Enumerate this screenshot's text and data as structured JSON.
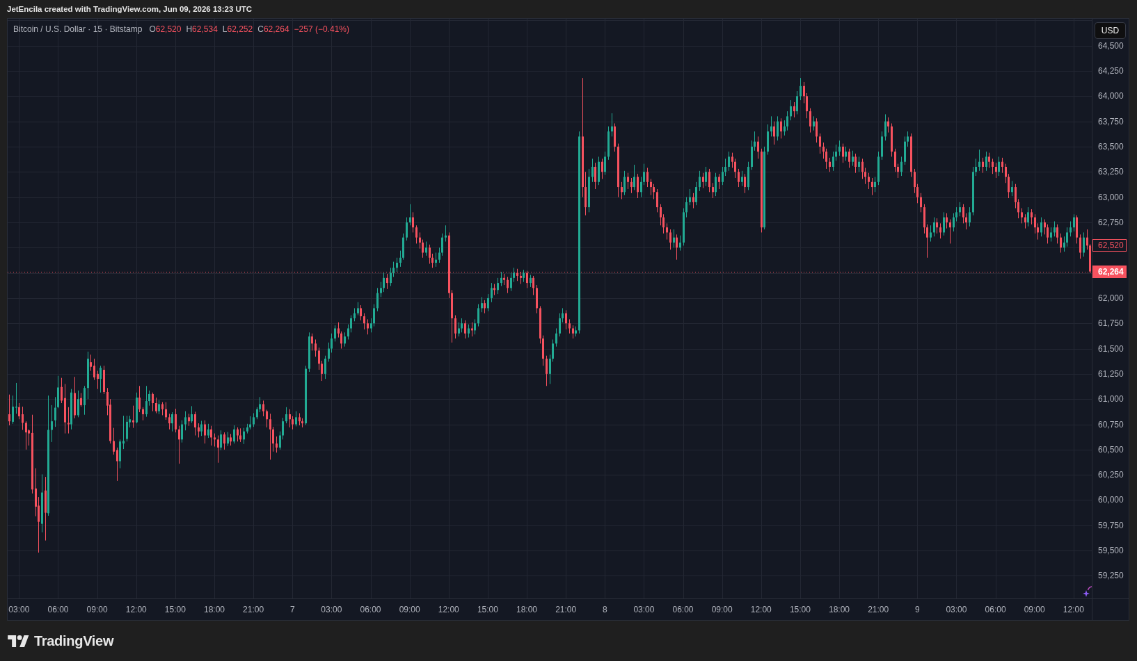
{
  "attribution": "JetEncila created with TradingView.com, Jun 09, 2026 13:23 UTC",
  "legend": {
    "title": "Bitcoin / U.S. Dollar · 15 · Bitstamp",
    "ohlc": [
      {
        "label": "O",
        "value": "62,520"
      },
      {
        "label": "H",
        "value": "62,534"
      },
      {
        "label": "L",
        "value": "62,252"
      },
      {
        "label": "C",
        "value": "62,264"
      }
    ],
    "change": "−257 (−0.41%)"
  },
  "price_scale": {
    "currency": "USD"
  },
  "chart_data": {
    "type": "candlestick",
    "grid": true,
    "ylim": [
      59026,
      64766
    ],
    "yticks": [
      {
        "value": 59250,
        "label": "59,250"
      },
      {
        "value": 59500,
        "label": "59,500"
      },
      {
        "value": 59750,
        "label": "59,750"
      },
      {
        "value": 60000,
        "label": "60,000"
      },
      {
        "value": 60250,
        "label": "60,250"
      },
      {
        "value": 60500,
        "label": "60,500"
      },
      {
        "value": 60750,
        "label": "60,750"
      },
      {
        "value": 61000,
        "label": "61,000"
      },
      {
        "value": 61250,
        "label": "61,250"
      },
      {
        "value": 61500,
        "label": "61,500"
      },
      {
        "value": 61750,
        "label": "61,750"
      },
      {
        "value": 62000,
        "label": "62,000"
      },
      {
        "value": 62750,
        "label": "62,750"
      },
      {
        "value": 63000,
        "label": "63,000"
      },
      {
        "value": 63250,
        "label": "63,250"
      },
      {
        "value": 63500,
        "label": "63,500"
      },
      {
        "value": 63750,
        "label": "63,750"
      },
      {
        "value": 64000,
        "label": "64,000"
      },
      {
        "value": 64250,
        "label": "64,250"
      },
      {
        "value": 64500,
        "label": "64,500"
      }
    ],
    "annotations": [
      "62,520"
    ],
    "ref_lines": [
      {
        "axis": "y",
        "value": 62264,
        "label": "62,264"
      }
    ],
    "categories": [
      null,
      null,
      null,
      "03:00",
      null,
      null,
      null,
      null,
      null,
      null,
      null,
      null,
      null,
      null,
      null,
      "06:00",
      null,
      null,
      null,
      null,
      null,
      null,
      null,
      null,
      null,
      null,
      null,
      "09:00",
      null,
      null,
      null,
      null,
      null,
      null,
      null,
      null,
      null,
      null,
      null,
      "12:00",
      null,
      null,
      null,
      null,
      null,
      null,
      null,
      null,
      null,
      null,
      null,
      "15:00",
      null,
      null,
      null,
      null,
      null,
      null,
      null,
      null,
      null,
      null,
      null,
      "18:00",
      null,
      null,
      null,
      null,
      null,
      null,
      null,
      null,
      null,
      null,
      null,
      "21:00",
      null,
      null,
      null,
      null,
      null,
      null,
      null,
      null,
      null,
      null,
      null,
      "7",
      null,
      null,
      null,
      null,
      null,
      null,
      null,
      null,
      null,
      null,
      null,
      "03:00",
      null,
      null,
      null,
      null,
      null,
      null,
      null,
      null,
      null,
      null,
      null,
      "06:00",
      null,
      null,
      null,
      null,
      null,
      null,
      null,
      null,
      null,
      null,
      null,
      "09:00",
      null,
      null,
      null,
      null,
      null,
      null,
      null,
      null,
      null,
      null,
      null,
      "12:00",
      null,
      null,
      null,
      null,
      null,
      null,
      null,
      null,
      null,
      null,
      null,
      "15:00",
      null,
      null,
      null,
      null,
      null,
      null,
      null,
      null,
      null,
      null,
      null,
      "18:00",
      null,
      null,
      null,
      null,
      null,
      null,
      null,
      null,
      null,
      null,
      null,
      "21:00",
      null,
      null,
      null,
      null,
      null,
      null,
      null,
      null,
      null,
      null,
      null,
      "8",
      null,
      null,
      null,
      null,
      null,
      null,
      null,
      null,
      null,
      null,
      null,
      "03:00",
      null,
      null,
      null,
      null,
      null,
      null,
      null,
      null,
      null,
      null,
      null,
      "06:00",
      null,
      null,
      null,
      null,
      null,
      null,
      null,
      null,
      null,
      null,
      null,
      "09:00",
      null,
      null,
      null,
      null,
      null,
      null,
      null,
      null,
      null,
      null,
      null,
      "12:00",
      null,
      null,
      null,
      null,
      null,
      null,
      null,
      null,
      null,
      null,
      null,
      "15:00",
      null,
      null,
      null,
      null,
      null,
      null,
      null,
      null,
      null,
      null,
      null,
      "18:00",
      null,
      null,
      null,
      null,
      null,
      null,
      null,
      null,
      null,
      null,
      null,
      "21:00",
      null,
      null,
      null,
      null,
      null,
      null,
      null,
      null,
      null,
      null,
      null,
      "9",
      null,
      null,
      null,
      null,
      null,
      null,
      null,
      null,
      null,
      null,
      null,
      "03:00",
      null,
      null,
      null,
      null,
      null,
      null,
      null,
      null,
      null,
      null,
      null,
      "06:00",
      null,
      null,
      null,
      null,
      null,
      null,
      null,
      null,
      null,
      null,
      null,
      "09:00",
      null,
      null,
      null,
      null,
      null,
      null,
      null,
      null,
      null,
      null,
      null,
      "12:00",
      null,
      null,
      null,
      null,
      null
    ],
    "ohlc": [
      [
        60850,
        61045,
        60740,
        60780
      ],
      [
        60775,
        61035,
        60755,
        60925
      ],
      [
        60915,
        61160,
        60855,
        60925
      ],
      [
        60920,
        60960,
        60800,
        60830
      ],
      [
        60850,
        60925,
        60695,
        60765
      ],
      [
        60765,
        60780,
        60500,
        60670
      ],
      [
        60690,
        60700,
        60540,
        60660
      ],
      [
        60665,
        60845,
        60065,
        60105
      ],
      [
        60115,
        60315,
        59840,
        59935
      ],
      [
        59945,
        60030,
        59480,
        59785
      ],
      [
        59765,
        60255,
        59680,
        60075
      ],
      [
        60095,
        60230,
        59600,
        59875
      ],
      [
        59870,
        61035,
        59845,
        60695
      ],
      [
        60695,
        60940,
        60575,
        60780
      ],
      [
        60790,
        61020,
        60725,
        60915
      ],
      [
        60920,
        61230,
        60910,
        61115
      ],
      [
        61120,
        61210,
        60960,
        60985
      ],
      [
        61010,
        61150,
        60660,
        60770
      ],
      [
        60765,
        60920,
        60660,
        60750
      ],
      [
        60750,
        61100,
        60700,
        61065
      ],
      [
        61060,
        61220,
        60810,
        60840
      ],
      [
        60840,
        61085,
        60820,
        61000
      ],
      [
        61010,
        61060,
        60925,
        60940
      ],
      [
        60940,
        61130,
        60845,
        61110
      ],
      [
        61110,
        61470,
        61000,
        61400
      ],
      [
        61365,
        61440,
        61280,
        61320
      ],
      [
        61330,
        61400,
        61190,
        61215
      ],
      [
        61250,
        61280,
        61100,
        61200
      ],
      [
        61200,
        61330,
        61065,
        61310
      ],
      [
        61290,
        61330,
        61050,
        61070
      ],
      [
        61070,
        61110,
        60840,
        60935
      ],
      [
        60945,
        61000,
        60560,
        60585
      ],
      [
        60585,
        60715,
        60450,
        60480
      ],
      [
        60495,
        60520,
        60190,
        60385
      ],
      [
        60385,
        60600,
        60315,
        60580
      ],
      [
        60560,
        60835,
        60505,
        60585
      ],
      [
        60605,
        60835,
        60580,
        60775
      ],
      [
        60770,
        60835,
        60720,
        60800
      ],
      [
        60790,
        60935,
        60715,
        60770
      ],
      [
        60770,
        61065,
        60760,
        61015
      ],
      [
        61015,
        61130,
        60870,
        60900
      ],
      [
        60900,
        60920,
        60790,
        60850
      ],
      [
        60850,
        61130,
        60825,
        60980
      ],
      [
        60980,
        61085,
        60935,
        61050
      ],
      [
        61050,
        61065,
        60880,
        60960
      ],
      [
        60960,
        61015,
        60860,
        60880
      ],
      [
        60880,
        60990,
        60850,
        60950
      ],
      [
        60950,
        60970,
        60840,
        60900
      ],
      [
        60900,
        60970,
        60795,
        60820
      ],
      [
        60820,
        60855,
        60700,
        60760
      ],
      [
        60760,
        60870,
        60680,
        60850
      ],
      [
        60850,
        60905,
        60670,
        60700
      ],
      [
        60700,
        60735,
        60360,
        60600
      ],
      [
        60600,
        60790,
        60570,
        60750
      ],
      [
        60750,
        60880,
        60690,
        60820
      ],
      [
        60820,
        60855,
        60735,
        60780
      ],
      [
        60780,
        60930,
        60765,
        60850
      ],
      [
        60850,
        60875,
        60640,
        60720
      ],
      [
        60720,
        60760,
        60620,
        60680
      ],
      [
        60680,
        60785,
        60635,
        60750
      ],
      [
        60750,
        60790,
        60560,
        60640
      ],
      [
        60640,
        60755,
        60615,
        60700
      ],
      [
        60700,
        60735,
        60540,
        60620
      ],
      [
        60620,
        60660,
        60530,
        60600
      ],
      [
        60600,
        60640,
        60370,
        60520
      ],
      [
        60520,
        60690,
        60495,
        60650
      ],
      [
        60650,
        60670,
        60500,
        60560
      ],
      [
        60560,
        60675,
        60535,
        60620
      ],
      [
        60620,
        60655,
        60540,
        60580
      ],
      [
        60580,
        60740,
        60560,
        60700
      ],
      [
        60700,
        60720,
        60580,
        60640
      ],
      [
        60640,
        60710,
        60575,
        60600
      ],
      [
        60600,
        60715,
        60555,
        60680
      ],
      [
        60680,
        60755,
        60660,
        60720
      ],
      [
        60720,
        60830,
        60700,
        60750
      ],
      [
        60750,
        60860,
        60725,
        60820
      ],
      [
        60820,
        60920,
        60800,
        60900
      ],
      [
        60900,
        61020,
        60870,
        60950
      ],
      [
        60950,
        60985,
        60830,
        60880
      ],
      [
        60880,
        60895,
        60720,
        60800
      ],
      [
        60800,
        60855,
        60400,
        60700
      ],
      [
        60700,
        60725,
        60480,
        60560
      ],
      [
        60560,
        60630,
        60470,
        60520
      ],
      [
        60520,
        60680,
        60500,
        60640
      ],
      [
        60640,
        60815,
        60600,
        60780
      ],
      [
        60780,
        60920,
        60760,
        60850
      ],
      [
        60850,
        60900,
        60720,
        60800
      ],
      [
        60800,
        60830,
        60700,
        60750
      ],
      [
        60750,
        60880,
        60730,
        60820
      ],
      [
        60820,
        60860,
        60740,
        60780
      ],
      [
        60780,
        60810,
        60720,
        60760
      ],
      [
        60760,
        61330,
        60745,
        61300
      ],
      [
        61300,
        61660,
        61270,
        61620
      ],
      [
        61620,
        61650,
        61480,
        61550
      ],
      [
        61550,
        61590,
        61420,
        61480
      ],
      [
        61480,
        61510,
        61290,
        61350
      ],
      [
        61350,
        61380,
        61180,
        61250
      ],
      [
        61250,
        61430,
        61200,
        61400
      ],
      [
        61400,
        61560,
        61370,
        61500
      ],
      [
        61500,
        61650,
        61460,
        61600
      ],
      [
        61600,
        61730,
        61570,
        61700
      ],
      [
        61700,
        61760,
        61610,
        61650
      ],
      [
        61650,
        61670,
        61500,
        61550
      ],
      [
        61550,
        61660,
        61520,
        61620
      ],
      [
        61620,
        61740,
        61590,
        61700
      ],
      [
        61700,
        61830,
        61660,
        61800
      ],
      [
        61800,
        61900,
        61770,
        61850
      ],
      [
        61850,
        61960,
        61830,
        61900
      ],
      [
        61900,
        61930,
        61780,
        61820
      ],
      [
        61820,
        61850,
        61690,
        61750
      ],
      [
        61750,
        61790,
        61640,
        61700
      ],
      [
        61700,
        61800,
        61660,
        61750
      ],
      [
        61750,
        61940,
        61720,
        61900
      ],
      [
        61900,
        62100,
        61870,
        62050
      ],
      [
        62050,
        62160,
        62010,
        62100
      ],
      [
        62100,
        62250,
        62060,
        62200
      ],
      [
        62200,
        62240,
        62090,
        62150
      ],
      [
        62150,
        62300,
        62120,
        62250
      ],
      [
        62250,
        62360,
        62210,
        62300
      ],
      [
        62300,
        62400,
        62260,
        62350
      ],
      [
        62350,
        62470,
        62310,
        62400
      ],
      [
        62400,
        62640,
        62380,
        62600
      ],
      [
        62600,
        62800,
        62570,
        62750
      ],
      [
        62750,
        62930,
        62720,
        62800
      ],
      [
        62800,
        62850,
        62650,
        62700
      ],
      [
        62700,
        62720,
        62540,
        62600
      ],
      [
        62600,
        62650,
        62490,
        62550
      ],
      [
        62550,
        62580,
        62400,
        62450
      ],
      [
        62450,
        62560,
        62420,
        62500
      ],
      [
        62500,
        62530,
        62340,
        62400
      ],
      [
        62400,
        62440,
        62300,
        62350
      ],
      [
        62350,
        62450,
        62310,
        62380
      ],
      [
        62380,
        62500,
        62350,
        62450
      ],
      [
        62450,
        62640,
        62420,
        62600
      ],
      [
        62600,
        62720,
        62560,
        62620
      ],
      [
        62620,
        62650,
        62000,
        62050
      ],
      [
        62050,
        62080,
        61560,
        61800
      ],
      [
        61800,
        61830,
        61600,
        61650
      ],
      [
        61650,
        61760,
        61620,
        61700
      ],
      [
        61700,
        61800,
        61660,
        61750
      ],
      [
        61750,
        61780,
        61600,
        61650
      ],
      [
        61650,
        61740,
        61610,
        61700
      ],
      [
        61700,
        61760,
        61620,
        61680
      ],
      [
        61680,
        61790,
        61640,
        61750
      ],
      [
        61750,
        61940,
        61720,
        61900
      ],
      [
        61900,
        62010,
        61860,
        61950
      ],
      [
        61950,
        61980,
        61850,
        61900
      ],
      [
        61900,
        62040,
        61870,
        62000
      ],
      [
        62000,
        62150,
        61960,
        62100
      ],
      [
        62100,
        62140,
        62030,
        62080
      ],
      [
        62080,
        62200,
        62040,
        62150
      ],
      [
        62150,
        62260,
        62120,
        62200
      ],
      [
        62200,
        62240,
        62130,
        62180
      ],
      [
        62180,
        62210,
        62050,
        62100
      ],
      [
        62100,
        62250,
        62070,
        62200
      ],
      [
        62200,
        62300,
        62160,
        62250
      ],
      [
        62250,
        62290,
        62170,
        62220
      ],
      [
        62220,
        62260,
        62140,
        62200
      ],
      [
        62200,
        62280,
        62160,
        62250
      ],
      [
        62250,
        62270,
        62100,
        62150
      ],
      [
        62150,
        62230,
        62110,
        62200
      ],
      [
        62200,
        62220,
        62030,
        62100
      ],
      [
        62100,
        62130,
        61850,
        61900
      ],
      [
        61900,
        61920,
        61550,
        61600
      ],
      [
        61600,
        61630,
        61330,
        61400
      ],
      [
        61400,
        61430,
        61130,
        61250
      ],
      [
        61250,
        61440,
        61150,
        61400
      ],
      [
        61400,
        61590,
        61370,
        61550
      ],
      [
        61550,
        61700,
        61520,
        61650
      ],
      [
        61650,
        61850,
        61620,
        61800
      ],
      [
        61800,
        61900,
        61760,
        61850
      ],
      [
        61850,
        61880,
        61690,
        61750
      ],
      [
        61750,
        61790,
        61650,
        61700
      ],
      [
        61700,
        61730,
        61600,
        61650
      ],
      [
        61650,
        61720,
        61620,
        61680
      ],
      [
        61680,
        63650,
        61650,
        63600
      ],
      [
        63600,
        64180,
        63000,
        63100
      ],
      [
        63100,
        63250,
        62820,
        62900
      ],
      [
        62900,
        63280,
        62850,
        63200
      ],
      [
        63200,
        63380,
        63150,
        63300
      ],
      [
        63300,
        63340,
        63080,
        63150
      ],
      [
        63150,
        63400,
        63120,
        63350
      ],
      [
        63350,
        63380,
        63180,
        63250
      ],
      [
        63250,
        63450,
        63220,
        63400
      ],
      [
        63400,
        63700,
        63370,
        63650
      ],
      [
        63650,
        63830,
        63600,
        63700
      ],
      [
        63700,
        63730,
        63450,
        63500
      ],
      [
        63500,
        63530,
        63000,
        63100
      ],
      [
        63100,
        63150,
        62980,
        63050
      ],
      [
        63050,
        63260,
        63020,
        63200
      ],
      [
        63200,
        63240,
        63080,
        63150
      ],
      [
        63150,
        63190,
        63040,
        63100
      ],
      [
        63100,
        63320,
        63070,
        63200
      ],
      [
        63200,
        63230,
        62990,
        63050
      ],
      [
        63050,
        63200,
        63000,
        63150
      ],
      [
        63150,
        63330,
        63120,
        63250
      ],
      [
        63250,
        63290,
        63100,
        63150
      ],
      [
        63150,
        63180,
        63020,
        63100
      ],
      [
        63100,
        63130,
        62980,
        63050
      ],
      [
        63050,
        63080,
        62850,
        62900
      ],
      [
        62900,
        62930,
        62720,
        62800
      ],
      [
        62800,
        62830,
        62640,
        62700
      ],
      [
        62700,
        62740,
        62580,
        62650
      ],
      [
        62650,
        62680,
        62480,
        62550
      ],
      [
        62550,
        62680,
        62500,
        62600
      ],
      [
        62600,
        62630,
        62380,
        62500
      ],
      [
        62500,
        62620,
        62470,
        62550
      ],
      [
        62550,
        62890,
        62520,
        62850
      ],
      [
        62850,
        63000,
        62800,
        62950
      ],
      [
        62950,
        63080,
        62920,
        63000
      ],
      [
        63000,
        63040,
        62890,
        62950
      ],
      [
        62950,
        63150,
        62920,
        63100
      ],
      [
        63100,
        63260,
        63060,
        63200
      ],
      [
        63200,
        63240,
        63090,
        63150
      ],
      [
        63150,
        63300,
        63110,
        63250
      ],
      [
        63250,
        63280,
        63050,
        63100
      ],
      [
        63100,
        63140,
        62990,
        63050
      ],
      [
        63050,
        63240,
        63010,
        63200
      ],
      [
        63200,
        63230,
        63080,
        63150
      ],
      [
        63150,
        63300,
        63120,
        63250
      ],
      [
        63250,
        63380,
        63210,
        63300
      ],
      [
        63300,
        63450,
        63260,
        63400
      ],
      [
        63400,
        63440,
        63290,
        63350
      ],
      [
        63350,
        63380,
        63190,
        63250
      ],
      [
        63250,
        63280,
        63100,
        63150
      ],
      [
        63150,
        63260,
        63110,
        63200
      ],
      [
        63200,
        63230,
        63040,
        63100
      ],
      [
        63100,
        63350,
        63070,
        63300
      ],
      [
        63300,
        63560,
        63270,
        63500
      ],
      [
        63500,
        63650,
        63460,
        63550
      ],
      [
        63550,
        63600,
        63380,
        63450
      ],
      [
        63450,
        63480,
        62650,
        62700
      ],
      [
        62700,
        63500,
        62680,
        63450
      ],
      [
        63450,
        63720,
        63420,
        63650
      ],
      [
        63650,
        63800,
        63600,
        63700
      ],
      [
        63700,
        63750,
        63520,
        63600
      ],
      [
        63600,
        63800,
        63560,
        63750
      ],
      [
        63750,
        63780,
        63580,
        63650
      ],
      [
        63650,
        63760,
        63610,
        63700
      ],
      [
        63700,
        63850,
        63660,
        63800
      ],
      [
        63800,
        63960,
        63760,
        63900
      ],
      [
        63900,
        63940,
        63790,
        63850
      ],
      [
        63850,
        64050,
        63820,
        64000
      ],
      [
        64000,
        64180,
        63960,
        64100
      ],
      [
        64100,
        64140,
        63930,
        64000
      ],
      [
        64000,
        64030,
        63780,
        63850
      ],
      [
        63850,
        63880,
        63640,
        63700
      ],
      [
        63700,
        63800,
        63660,
        63750
      ],
      [
        63750,
        63780,
        63540,
        63600
      ],
      [
        63600,
        63630,
        63430,
        63500
      ],
      [
        63500,
        63540,
        63380,
        63450
      ],
      [
        63450,
        63480,
        63280,
        63350
      ],
      [
        63350,
        63390,
        63250,
        63300
      ],
      [
        63300,
        63450,
        63260,
        63400
      ],
      [
        63400,
        63520,
        63360,
        63450
      ],
      [
        63450,
        63560,
        63410,
        63500
      ],
      [
        63500,
        63530,
        63340,
        63400
      ],
      [
        63400,
        63500,
        63360,
        63450
      ],
      [
        63450,
        63480,
        63290,
        63350
      ],
      [
        63350,
        63460,
        63310,
        63400
      ],
      [
        63400,
        63430,
        63240,
        63300
      ],
      [
        63300,
        63400,
        63250,
        63350
      ],
      [
        63350,
        63380,
        63180,
        63250
      ],
      [
        63250,
        63290,
        63130,
        63200
      ],
      [
        63200,
        63240,
        63080,
        63150
      ],
      [
        63150,
        63190,
        63020,
        63100
      ],
      [
        63100,
        63200,
        63050,
        63150
      ],
      [
        63150,
        63450,
        63120,
        63400
      ],
      [
        63400,
        63650,
        63370,
        63600
      ],
      [
        63600,
        63820,
        63560,
        63750
      ],
      [
        63750,
        63790,
        63640,
        63700
      ],
      [
        63700,
        63730,
        63400,
        63450
      ],
      [
        63450,
        63480,
        63250,
        63300
      ],
      [
        63300,
        63330,
        63190,
        63250
      ],
      [
        63250,
        63400,
        63210,
        63350
      ],
      [
        63350,
        63600,
        63320,
        63550
      ],
      [
        63550,
        63650,
        63500,
        63600
      ],
      [
        63600,
        63630,
        63200,
        63250
      ],
      [
        63250,
        63280,
        63040,
        63100
      ],
      [
        63100,
        63130,
        62940,
        63000
      ],
      [
        63000,
        63040,
        62850,
        62900
      ],
      [
        62900,
        62930,
        62640,
        62700
      ],
      [
        62700,
        62730,
        62400,
        62600
      ],
      [
        62600,
        62720,
        62560,
        62650
      ],
      [
        62650,
        62800,
        62610,
        62750
      ],
      [
        62750,
        62790,
        62640,
        62700
      ],
      [
        62700,
        62740,
        62590,
        62650
      ],
      [
        62650,
        62850,
        62620,
        62800
      ],
      [
        62800,
        62840,
        62690,
        62750
      ],
      [
        62750,
        62780,
        62540,
        62700
      ],
      [
        62700,
        62840,
        62660,
        62800
      ],
      [
        62800,
        62900,
        62760,
        62850
      ],
      [
        62850,
        62950,
        62810,
        62900
      ],
      [
        62900,
        62930,
        62740,
        62800
      ],
      [
        62800,
        62840,
        62680,
        62750
      ],
      [
        62750,
        62900,
        62710,
        62850
      ],
      [
        62850,
        63300,
        62820,
        63250
      ],
      [
        63250,
        63380,
        63210,
        63300
      ],
      [
        63300,
        63470,
        63260,
        63350
      ],
      [
        63350,
        63390,
        63240,
        63300
      ],
      [
        63300,
        63450,
        63260,
        63400
      ],
      [
        63400,
        63440,
        63290,
        63350
      ],
      [
        63350,
        63380,
        63230,
        63300
      ],
      [
        63300,
        63340,
        63190,
        63250
      ],
      [
        63250,
        63400,
        63210,
        63350
      ],
      [
        63350,
        63390,
        63240,
        63300
      ],
      [
        63300,
        63330,
        63140,
        63200
      ],
      [
        63200,
        63230,
        62990,
        63050
      ],
      [
        63050,
        63160,
        63010,
        63100
      ],
      [
        63100,
        63130,
        62890,
        62950
      ],
      [
        62950,
        62980,
        62790,
        62850
      ],
      [
        62850,
        62890,
        62740,
        62800
      ],
      [
        62800,
        62830,
        62690,
        62750
      ],
      [
        62750,
        62900,
        62710,
        62850
      ],
      [
        62850,
        62880,
        62730,
        62800
      ],
      [
        62800,
        62830,
        62640,
        62700
      ],
      [
        62700,
        62740,
        62580,
        62650
      ],
      [
        62650,
        62800,
        62610,
        62750
      ],
      [
        62750,
        62780,
        62630,
        62700
      ],
      [
        62700,
        62730,
        62540,
        62600
      ],
      [
        62600,
        62700,
        62560,
        62650
      ],
      [
        62650,
        62760,
        62610,
        62700
      ],
      [
        62700,
        62730,
        62540,
        62600
      ],
      [
        62600,
        62640,
        62450,
        62500
      ],
      [
        62500,
        62610,
        62460,
        62550
      ],
      [
        62550,
        62700,
        62510,
        62650
      ],
      [
        62650,
        62760,
        62610,
        62700
      ],
      [
        62700,
        62830,
        62660,
        62800
      ],
      [
        62800,
        62820,
        62540,
        62600
      ],
      [
        62600,
        62630,
        62390,
        62450
      ],
      [
        62450,
        62650,
        62410,
        62600
      ],
      [
        62600,
        62680,
        62480,
        62520
      ],
      [
        62520,
        62534,
        62252,
        62264
      ]
    ]
  },
  "footer": {
    "brand": "TradingView"
  }
}
